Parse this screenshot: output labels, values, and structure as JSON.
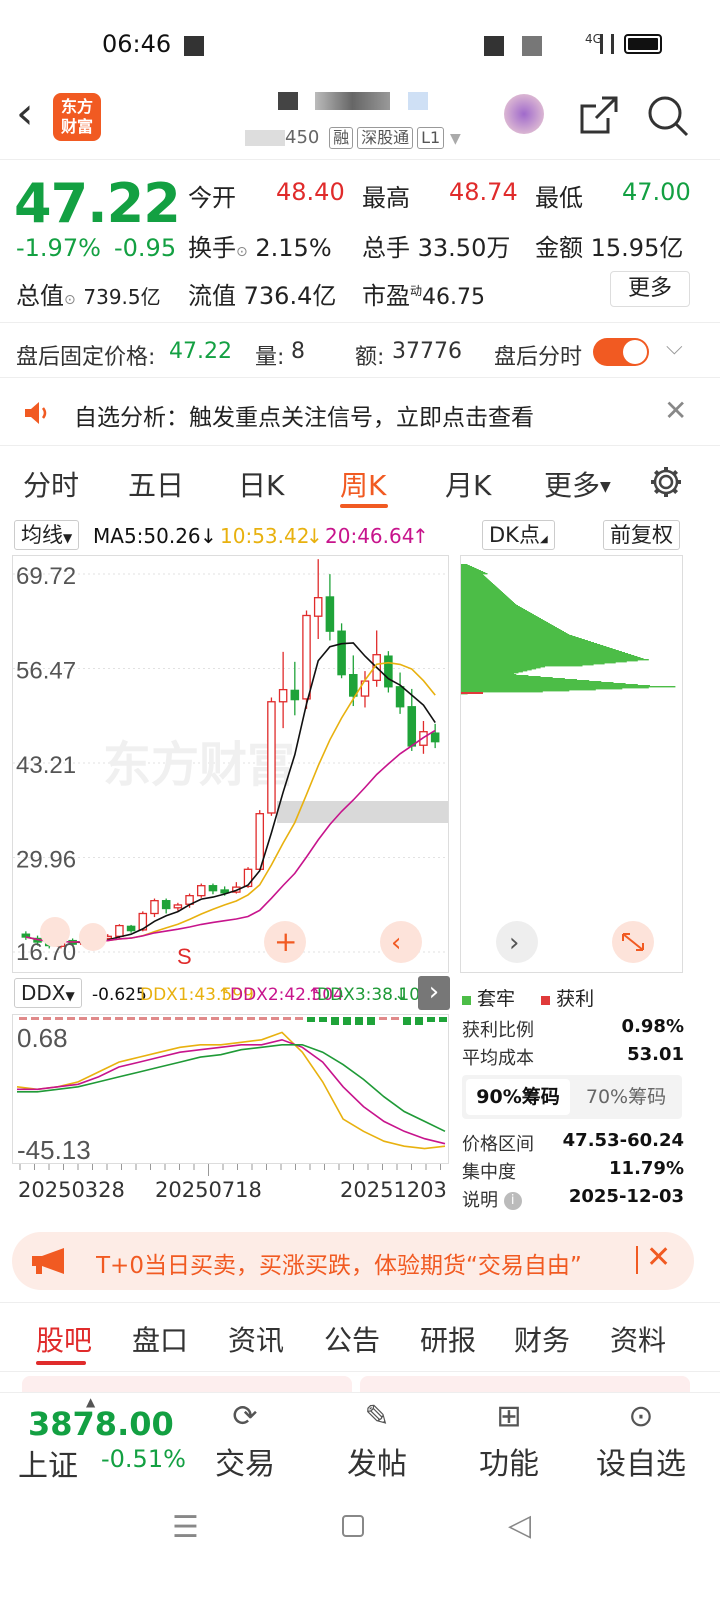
{
  "status": {
    "time": "06:46",
    "network": "4G"
  },
  "header": {
    "logo_text": "东方财富",
    "code_suffix": "450",
    "tag_margin": "融",
    "tag_connect": "深股通",
    "tag_level": "L1"
  },
  "quote": {
    "price": "47.22",
    "change_pct": "-1.97%",
    "change": "-0.95",
    "open_label": "今开",
    "open": "48.40",
    "high_label": "最高",
    "high": "48.74",
    "low_label": "最低",
    "low": "47.00",
    "turnover_label": "换手",
    "turnover": "2.15%",
    "volume_label": "总手",
    "volume": "33.50万",
    "amount_label": "金额",
    "amount": "15.95亿",
    "mcap_label": "总值",
    "mcap": "739.5亿",
    "float_label": "流值",
    "float": "736.4亿",
    "pe_label": "市盈",
    "pe_sup": "动",
    "pe": "46.75",
    "more": "更多"
  },
  "after_hours": {
    "price_label": "盘后固定价格:",
    "price": "47.22",
    "vol_label": "量:",
    "vol": "8",
    "amt_label": "额:",
    "amt": "37776",
    "toggle_label": "盘后分时"
  },
  "alert": {
    "text": "自选分析：触发重点关注信号，立即点击查看"
  },
  "tabs": [
    "分时",
    "五日",
    "日K",
    "周K",
    "月K",
    "更多"
  ],
  "active_tab": "周K",
  "chart_controls": {
    "ma_select": "均线",
    "ma5": "MA5:50.26",
    "ma10": "10:53.42",
    "ma20": "20:46.64",
    "dk": "DK点",
    "adjust": "前复权"
  },
  "chart_data": [
    {
      "type": "candlestick",
      "y_ticks": [
        "69.72",
        "56.47",
        "43.21",
        "29.96",
        "16.70"
      ],
      "ylim": [
        16.7,
        69.72
      ],
      "watermark": "东方财富",
      "marker": "S",
      "candles": [
        [
          19.2,
          19.6,
          18.4,
          18.8
        ],
        [
          18.6,
          19.0,
          17.6,
          18.1
        ],
        [
          18.0,
          18.3,
          17.2,
          17.6
        ],
        [
          17.5,
          18.4,
          17.2,
          18.2
        ],
        [
          18.3,
          18.6,
          17.5,
          17.8
        ],
        [
          17.8,
          18.7,
          17.6,
          18.4
        ],
        [
          18.4,
          18.9,
          18.0,
          18.6
        ],
        [
          18.6,
          19.2,
          18.2,
          18.9
        ],
        [
          18.9,
          20.6,
          18.6,
          20.4
        ],
        [
          20.3,
          20.5,
          19.4,
          19.7
        ],
        [
          19.8,
          22.4,
          19.6,
          22.1
        ],
        [
          22.1,
          24.2,
          21.6,
          23.9
        ],
        [
          23.9,
          24.2,
          22.1,
          22.8
        ],
        [
          22.9,
          23.6,
          22.5,
          23.3
        ],
        [
          23.4,
          24.9,
          22.9,
          24.6
        ],
        [
          24.6,
          26.3,
          24.3,
          26.0
        ],
        [
          26.0,
          26.3,
          24.8,
          25.3
        ],
        [
          25.4,
          25.9,
          24.6,
          25.0
        ],
        [
          25.1,
          26.5,
          24.9,
          25.8
        ],
        [
          25.9,
          28.6,
          25.7,
          28.3
        ],
        [
          28.3,
          36.6,
          28.0,
          36.1
        ],
        [
          36.2,
          52.4,
          35.8,
          51.8
        ],
        [
          51.8,
          58.8,
          48.1,
          53.5
        ],
        [
          53.4,
          57.4,
          49.9,
          52.1
        ],
        [
          52.2,
          64.6,
          50.8,
          63.9
        ],
        [
          63.8,
          71.8,
          60.6,
          66.4
        ],
        [
          66.5,
          69.7,
          60.4,
          61.7
        ],
        [
          61.7,
          62.8,
          55.1,
          55.6
        ],
        [
          55.6,
          58.3,
          51.2,
          52.6
        ],
        [
          52.6,
          56.1,
          51.0,
          54.7
        ],
        [
          54.8,
          61.8,
          53.9,
          58.4
        ],
        [
          58.2,
          58.9,
          53.1,
          53.9
        ],
        [
          53.9,
          55.9,
          50.1,
          51.1
        ],
        [
          51.1,
          53.6,
          44.9,
          45.6
        ],
        [
          45.7,
          49.1,
          44.5,
          47.6
        ],
        [
          47.4,
          48.7,
          45.3,
          46.2
        ]
      ],
      "ma_lines": {
        "ma5": "#111111",
        "ma10": "#e8b10f",
        "ma20": "#c7148c"
      }
    },
    {
      "type": "bar",
      "name": "chip-distribution",
      "legend": [
        "套牢",
        "获利"
      ],
      "colors": {
        "套牢": "#4cbd47",
        "获利": "#e03a3a"
      }
    },
    {
      "type": "line",
      "indicator": "DDX",
      "header": "DDX",
      "ddx_value": "-0.625",
      "series": [
        {
          "name": "DDX1:43.599",
          "color": "#e8b10f",
          "values": [
            -20,
            -21,
            -20,
            -18,
            -14,
            -10,
            -8,
            -6,
            -4,
            -3,
            -3,
            -2,
            -1,
            2,
            -6,
            -18,
            -33,
            -38,
            -42,
            -44,
            -45,
            -44
          ]
        },
        {
          "name": "DDX2:42.504",
          "color": "#c7148c",
          "values": [
            -21,
            -21,
            -20,
            -19,
            -16,
            -12,
            -10,
            -8,
            -6,
            -5,
            -4,
            -3,
            -3,
            -1,
            -4,
            -10,
            -20,
            -28,
            -34,
            -38,
            -41,
            -43
          ]
        },
        {
          "name": "DDX3:38.100",
          "color": "#1f9a37",
          "values": [
            -22,
            -22,
            -21,
            -20,
            -18,
            -16,
            -14,
            -12,
            -10,
            -8,
            -7,
            -5,
            -4,
            -3,
            -3,
            -6,
            -11,
            -17,
            -24,
            -30,
            -34,
            -38
          ]
        }
      ],
      "y_ticks": [
        "0.68",
        "-45.13"
      ],
      "x_ticks": [
        "20250328",
        "20250718",
        "20251203"
      ]
    }
  ],
  "chip_info": {
    "legend_locked": "套牢",
    "legend_profit": "获利",
    "rows": [
      {
        "k": "获利比例",
        "v": "0.98%"
      },
      {
        "k": "平均成本",
        "v": "53.01"
      }
    ],
    "tab90": "90%筹码",
    "tab70": "70%筹码",
    "rows2": [
      {
        "k": "价格区间",
        "v": "47.53-60.24"
      },
      {
        "k": "集中度",
        "v": "11.79%"
      },
      {
        "k": "说明",
        "v": "2025-12-03"
      }
    ]
  },
  "banner": {
    "text": "T+0当日买卖，买涨买跌，体验期货“交易自由”"
  },
  "bottom_tabs": [
    "股吧",
    "盘口",
    "资讯",
    "公告",
    "研报",
    "财务",
    "资料"
  ],
  "footer": {
    "index_value": "3878.00",
    "index_name": "上证",
    "index_change": "-0.51%",
    "trade": "交易",
    "post": "发帖",
    "func": "功能",
    "add": "设自选"
  }
}
